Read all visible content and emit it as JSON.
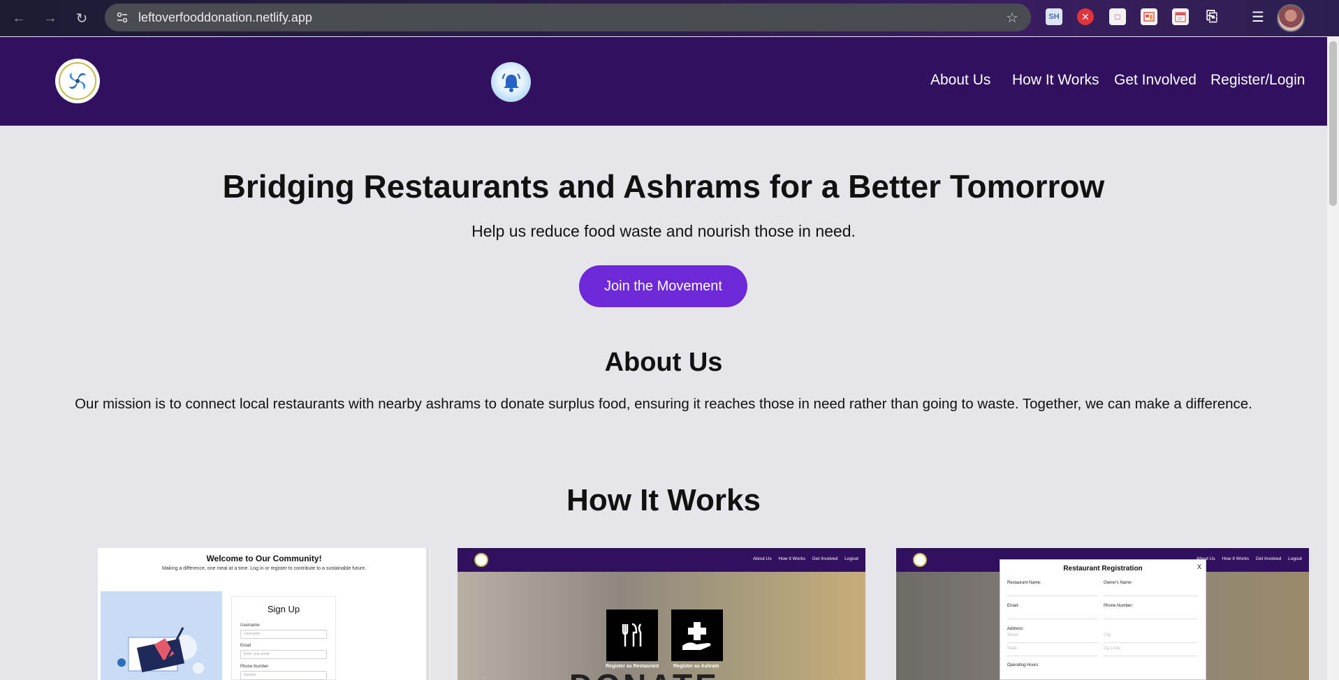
{
  "browser": {
    "url": "leftoverfooddonation.netlify.app",
    "extensions": [
      "sh-extension-icon",
      "close-extension-icon",
      "pocket-icon",
      "grid-extension-icon",
      "calendar-extension-icon",
      "puzzle-icon"
    ],
    "ext_sh_label": "SH"
  },
  "header": {
    "nav": [
      "About Us",
      "How It Works",
      "Get Involved",
      "Register/Login"
    ]
  },
  "hero": {
    "title": "Bridging Restaurants and Ashrams for a Better Tomorrow",
    "subtitle": "Help us reduce food waste and nourish those in need.",
    "cta_label": "Join the Movement"
  },
  "about": {
    "title": "About Us",
    "text": "Our mission is to connect local restaurants with nearby ashrams to donate surplus food, ensuring it reaches those in need rather than going to waste. Together, we can make a difference."
  },
  "how": {
    "title": "How It Works",
    "card1": {
      "title": "Welcome to Our Community!",
      "subtitle": "Making a difference, one meal at a time. Log in or register to contribute to a sustainable future.",
      "form_title": "Sign Up",
      "username_label": "Username",
      "username_placeholder": "Username",
      "email_label": "Email",
      "email_placeholder": "Enter your email",
      "phone_label": "Phone Number",
      "phone_placeholder": "Number"
    },
    "card2": {
      "nav": [
        "About Us",
        "How It Works",
        "Get Involved",
        "Logout"
      ],
      "tile1_label": "Register as Restaurant",
      "tile2_label": "Register as Ashram",
      "photo_text": "DONATE"
    },
    "card3": {
      "nav": [
        "About Us",
        "How It Works",
        "Get Involved",
        "Logout"
      ],
      "modal_title": "Restaurant Registration",
      "close_label": "X",
      "restaurant_name_label": "Restaurant Name:",
      "owner_name_label": "Owner's Name:",
      "email_label": "Email:",
      "phone_label": "Phone Number:",
      "address_label": "Address:",
      "street_placeholder": "Street",
      "city_placeholder": "City",
      "state_placeholder": "State",
      "zip_placeholder": "Zip Code",
      "hours_label": "Operating Hours:"
    }
  },
  "colors": {
    "header_bg": "#30105f",
    "cta_bg": "#6d28d9",
    "page_bg": "#e6e6ea"
  }
}
